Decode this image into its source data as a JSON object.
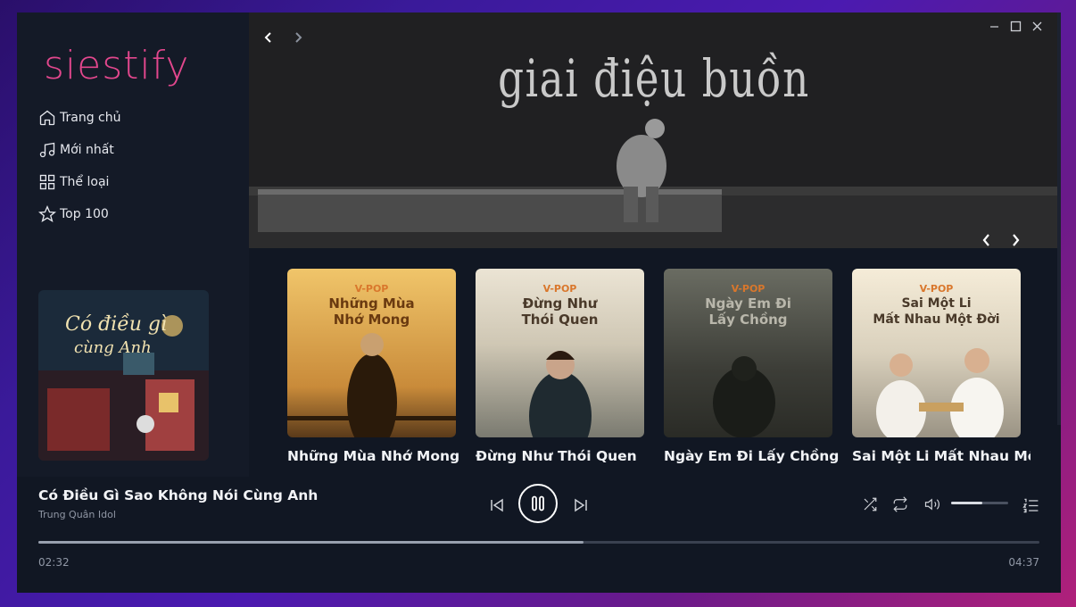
{
  "app": {
    "logo": "siestify"
  },
  "sidebar": {
    "items": [
      {
        "label": "Trang chủ",
        "icon": "home-icon"
      },
      {
        "label": "Mới nhất",
        "icon": "music-note-icon"
      },
      {
        "label": "Thể loại",
        "icon": "grid-icon"
      },
      {
        "label": "Top 100",
        "icon": "star-icon"
      }
    ]
  },
  "banner": {
    "title": "giai điệu buồn"
  },
  "playlists": [
    {
      "tag": "V-POP",
      "art_line1": "Những Mùa",
      "art_line2": "Nhớ Mong",
      "title": "Những Mùa Nhớ Mong",
      "color1": "#c98b3a",
      "color2": "#f0c56a"
    },
    {
      "tag": "V-POP",
      "art_line1": "Đừng Như",
      "art_line2": "Thói Quen",
      "title": "Đừng Như Thói Quen",
      "color1": "#8e8a80",
      "color2": "#d9d3c4"
    },
    {
      "tag": "V-POP",
      "art_line1": "Ngày Em Đi",
      "art_line2": "Lấy Chồng",
      "title": "Ngày Em Đi Lấy Chồng",
      "color1": "#3c3d37",
      "color2": "#8a8c80"
    },
    {
      "tag": "V-POP",
      "art_line1": "Sai Một Li",
      "art_line2": "Mất Nhau Một Đời",
      "title": "Sai Một Li Mất Nhau Một",
      "color1": "#b7b1a0",
      "color2": "#efe6d4"
    }
  ],
  "now_playing": {
    "title": "Có Điều Gì Sao Không Nói Cùng Anh",
    "artist": "Trung Quân Idol",
    "current_time": "02:32",
    "total_time": "04:37",
    "progress": 0.545,
    "volume": 0.55
  },
  "colors": {
    "accent": "#e2478d",
    "background": "#111723",
    "sidebar": "#141a27"
  }
}
